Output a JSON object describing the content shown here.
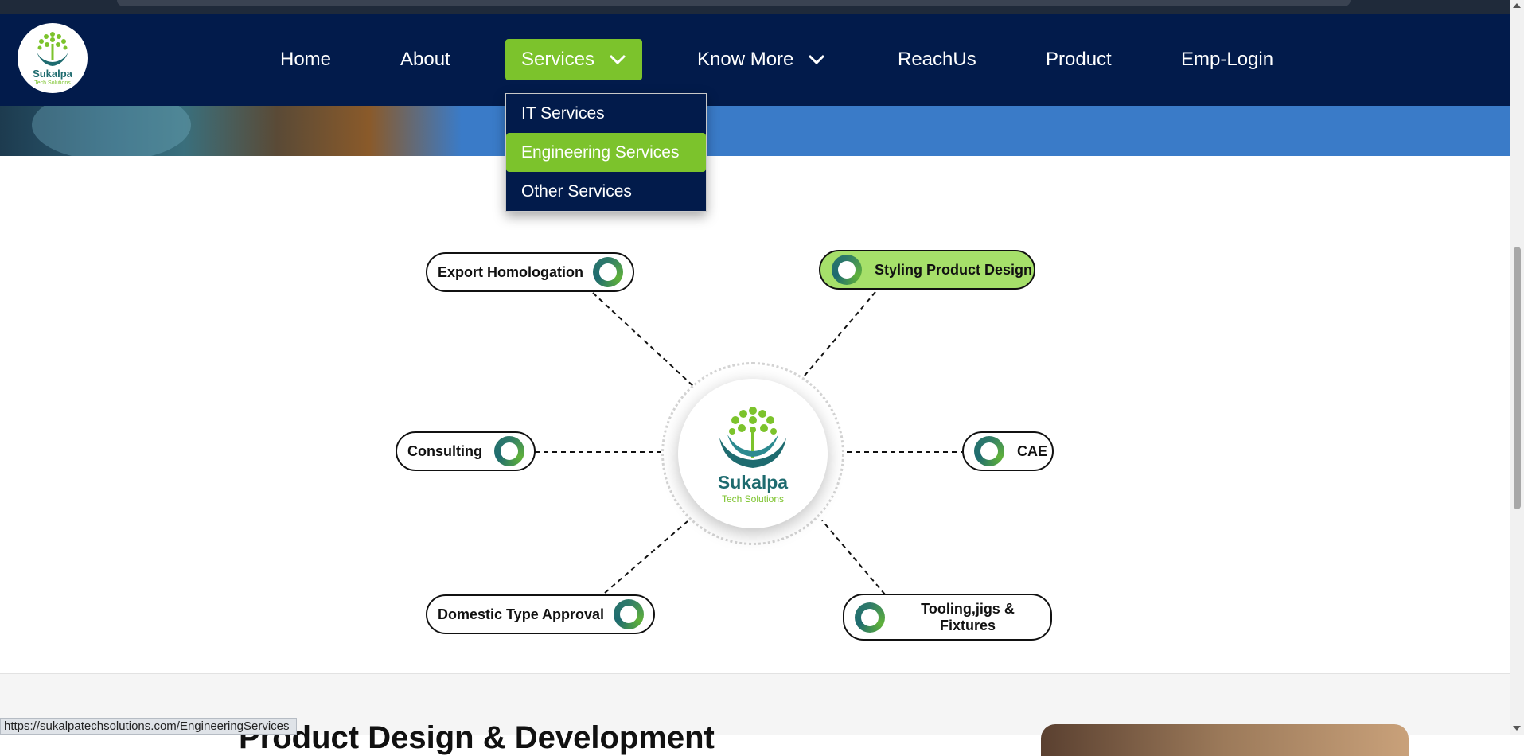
{
  "brand": {
    "name": "Sukalpa",
    "tagline": "Tech Solutions",
    "colors": {
      "navy": "#021b4b",
      "green": "#7cc32c",
      "teal": "#1e6b6f"
    }
  },
  "nav": {
    "items": [
      {
        "label": "Home"
      },
      {
        "label": "About"
      },
      {
        "label": "Services"
      },
      {
        "label": "Know More"
      },
      {
        "label": "ReachUs"
      },
      {
        "label": "Product"
      },
      {
        "label": "Emp-Login"
      }
    ],
    "active": "Services"
  },
  "dropdown": {
    "items": [
      {
        "label": "IT Services"
      },
      {
        "label": "Engineering Services"
      },
      {
        "label": "Other Services"
      }
    ],
    "highlighted": "Engineering Services"
  },
  "services": {
    "nodes": [
      {
        "label": "Export Homologation"
      },
      {
        "label": "Styling Product Design"
      },
      {
        "label": "Consulting"
      },
      {
        "label": "CAE"
      },
      {
        "label": "Domestic Type Approval"
      },
      {
        "label": "Tooling,jigs & Fixtures"
      }
    ],
    "highlighted": "Styling Product Design",
    "ring_icon": "ring-icon"
  },
  "next_section": {
    "heading": "Product Design & Development"
  },
  "status_bar": {
    "url": "https://sukalpatechsolutions.com/EngineeringServices"
  }
}
